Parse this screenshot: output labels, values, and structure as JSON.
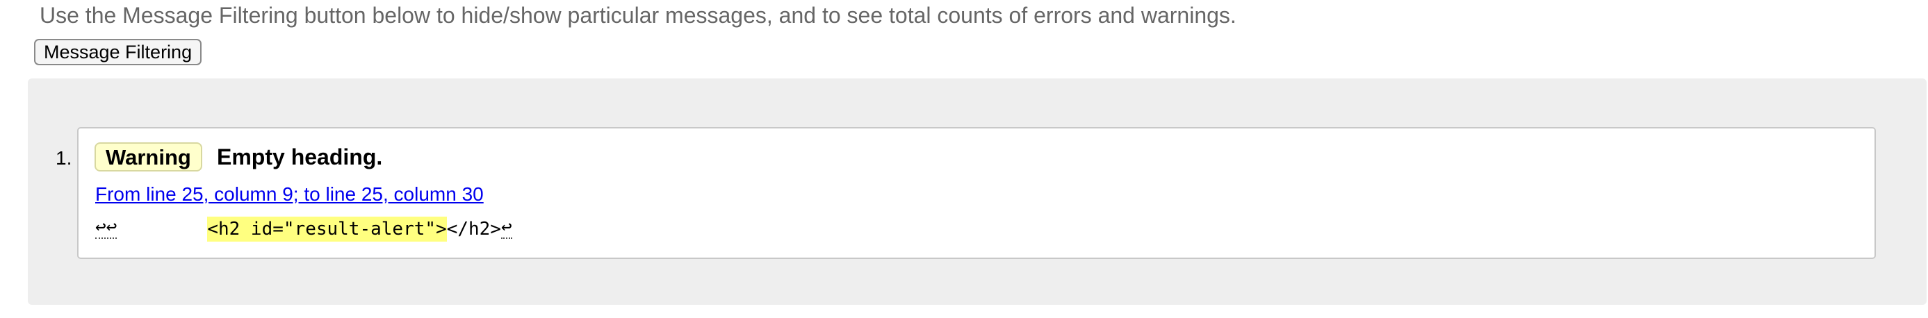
{
  "intro_text": "Use the Message Filtering button below to hide/show particular messages, and to see total counts of errors and warnings.",
  "filter_button_label": "Message Filtering",
  "colors": {
    "results_background": "#eeeeee",
    "warning_badge_background": "#ffffcc",
    "highlight": "#ffff80",
    "link": "#0000ee"
  },
  "messages": [
    {
      "number": "1.",
      "type": "Warning",
      "text": "Empty heading.",
      "location": "From line 25, column 9; to line 25, column 30",
      "extract": {
        "before": "↩↩",
        "highlighted": "<h2 id=\"result-alert\">",
        "after": "</h2>",
        "trailing": "↩"
      }
    }
  ]
}
